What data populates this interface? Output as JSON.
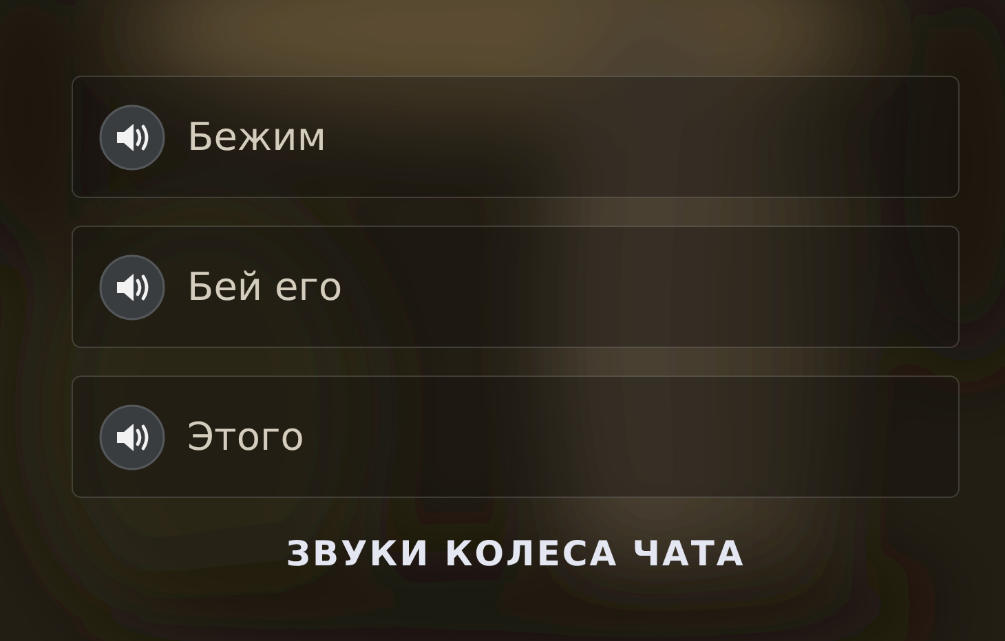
{
  "sounds": [
    {
      "label": "Бежим"
    },
    {
      "label": "Бей его"
    },
    {
      "label": "Этого"
    }
  ],
  "footer_title": "ЗВУКИ КОЛЕСА ЧАТА"
}
